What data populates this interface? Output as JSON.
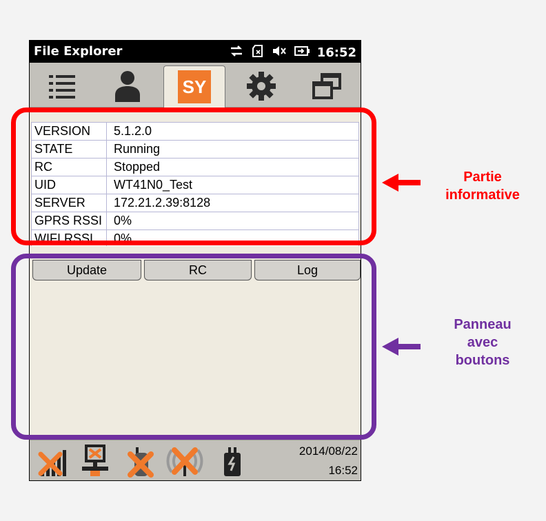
{
  "statusbar": {
    "title": "File Explorer",
    "time": "16:52",
    "icons": [
      "sync-icon",
      "sd-card-icon",
      "speaker-muted-icon",
      "battery-charging-icon"
    ]
  },
  "tabs": [
    {
      "name": "list-icon"
    },
    {
      "name": "user-icon"
    },
    {
      "name": "sy-logo",
      "label": "SY",
      "active": true
    },
    {
      "name": "gear-icon"
    },
    {
      "name": "windows-icon"
    }
  ],
  "info": {
    "rows": [
      {
        "key": "VERSION",
        "value": "5.1.2.0"
      },
      {
        "key": "STATE",
        "value": "Running"
      },
      {
        "key": "RC",
        "value": "Stopped"
      },
      {
        "key": "UID",
        "value": "WT41N0_Test"
      },
      {
        "key": "SERVER",
        "value": "172.21.2.39:8128"
      },
      {
        "key": "GPRS RSSI",
        "value": "0%"
      },
      {
        "key": "WIFI RSSI",
        "value": "0%"
      }
    ]
  },
  "buttons": {
    "update": "Update",
    "rc": "RC",
    "log": "Log"
  },
  "bottombar": {
    "date": "2014/08/22",
    "time": "16:52",
    "icons": [
      "signal-off-icon",
      "network-off-icon",
      "gps-off-icon",
      "wifi-off-icon",
      "power-plug-icon"
    ]
  },
  "annotations": {
    "info_label": [
      "Partie",
      "informative"
    ],
    "buttons_label": [
      "Panneau",
      "avec",
      "boutons"
    ],
    "colors": {
      "red": "#ff0000",
      "purple": "#7030a0",
      "accent": "#f07a2c"
    }
  }
}
